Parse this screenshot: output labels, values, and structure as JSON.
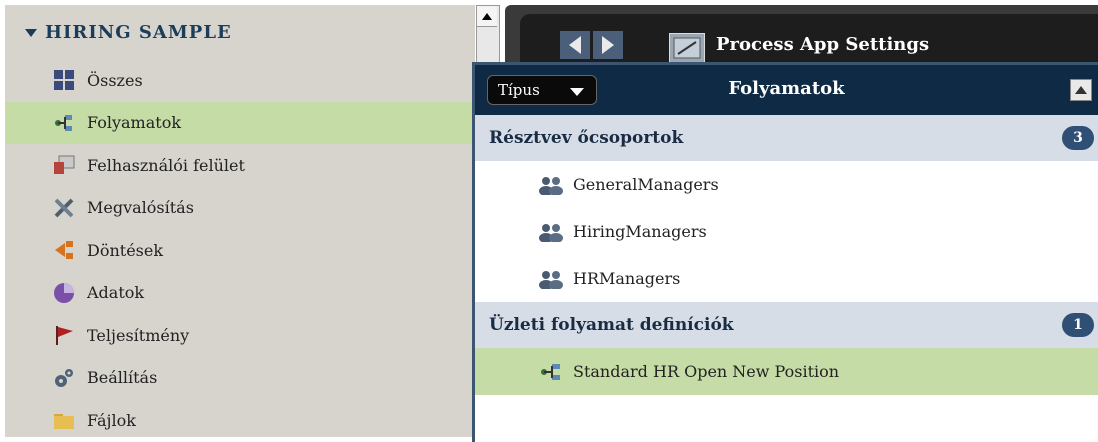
{
  "library": {
    "title": "HIRING SAMPLE"
  },
  "nav": [
    {
      "label": "Összes",
      "icon": "grid-icon"
    },
    {
      "label": "Folyamatok",
      "icon": "process-icon",
      "active": true
    },
    {
      "label": "Felhasználói felület",
      "icon": "ui-icon"
    },
    {
      "label": "Megvalósítás",
      "icon": "tools-icon"
    },
    {
      "label": "Döntések",
      "icon": "decision-icon"
    },
    {
      "label": "Adatok",
      "icon": "data-icon"
    },
    {
      "label": "Teljesítmény",
      "icon": "flag-icon"
    },
    {
      "label": "Beállítás",
      "icon": "gear-icon"
    },
    {
      "label": "Fájlok",
      "icon": "folder-icon"
    }
  ],
  "topbar": {
    "title": "Process App Settings"
  },
  "panel": {
    "type_label": "Típus",
    "title": "Folyamatok",
    "sections": [
      {
        "title": "Résztvev őcsoportok",
        "count": "3",
        "items": [
          "GeneralManagers",
          "HiringManagers",
          "HRManagers"
        ]
      },
      {
        "title": "Üzleti folyamat definíciók",
        "count": "1",
        "items": [
          "Standard HR Open New Position"
        ]
      }
    ]
  },
  "colors": {
    "active_row": "#c6dca6",
    "panel_header": "#0f2a45",
    "section_bg": "#d6dde6",
    "badge": "#2f4f74"
  }
}
